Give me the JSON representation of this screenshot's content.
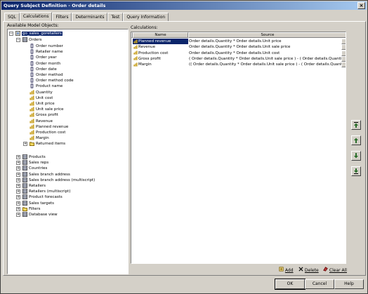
{
  "window": {
    "title": "Query Subject Definition - Order details",
    "close_label": "×"
  },
  "tabs": [
    "SQL",
    "Calculations",
    "Filters",
    "Determinants",
    "Test",
    "Query Information"
  ],
  "left_panel": {
    "label": "Available Model Objects:",
    "root": "go_sales_goretailers",
    "orders": "Orders",
    "order_items": [
      "Order number",
      "Retailer name",
      "Order year",
      "Order month",
      "Order date",
      "Order method",
      "Order method code",
      "Product name",
      "Quantity",
      "Unit cost",
      "Unit price",
      "Unit sale price",
      "Gross profit",
      "Revenue",
      "Planned revenue",
      "Production cost",
      "Margin",
      "Returned items"
    ],
    "top_items": [
      "Products",
      "Sales reps",
      "Countries",
      "Sales branch address",
      "Sales branch address (multiscript)",
      "Retailers",
      "Retailers (multiscript)",
      "Product forecasts",
      "Sales targets",
      "Filters",
      "Database view"
    ]
  },
  "calculations": {
    "label": "Calculations:",
    "columns": [
      "Name",
      "Source"
    ],
    "rows": [
      {
        "name": "Planned revenue",
        "source": "Order details.Quantity * Order details.Unit price"
      },
      {
        "name": "Revenue",
        "source": "Order details.Quantity * Order details.Unit sale price"
      },
      {
        "name": "Production cost",
        "source": "Order details.Quantity * Order details.Unit cost"
      },
      {
        "name": "Gross profit",
        "source": "( Order details.Quantity * Order details.Unit sale price ) - ( Order details.Quantity * Order det"
      },
      {
        "name": "Margin",
        "source": "(( Order details.Quantity * Order details.Unit sale price ) - ( Order details.Quantity * Order det"
      }
    ],
    "selected_row": 0
  },
  "actions": {
    "add": "Add",
    "delete": "Delete",
    "clear_all": "Clear All"
  },
  "buttons": {
    "ok": "OK",
    "cancel": "Cancel",
    "help": "Help"
  },
  "colors": {
    "selection": "#0a246a",
    "title_start": "#0a246a",
    "title_end": "#a6caf0"
  }
}
